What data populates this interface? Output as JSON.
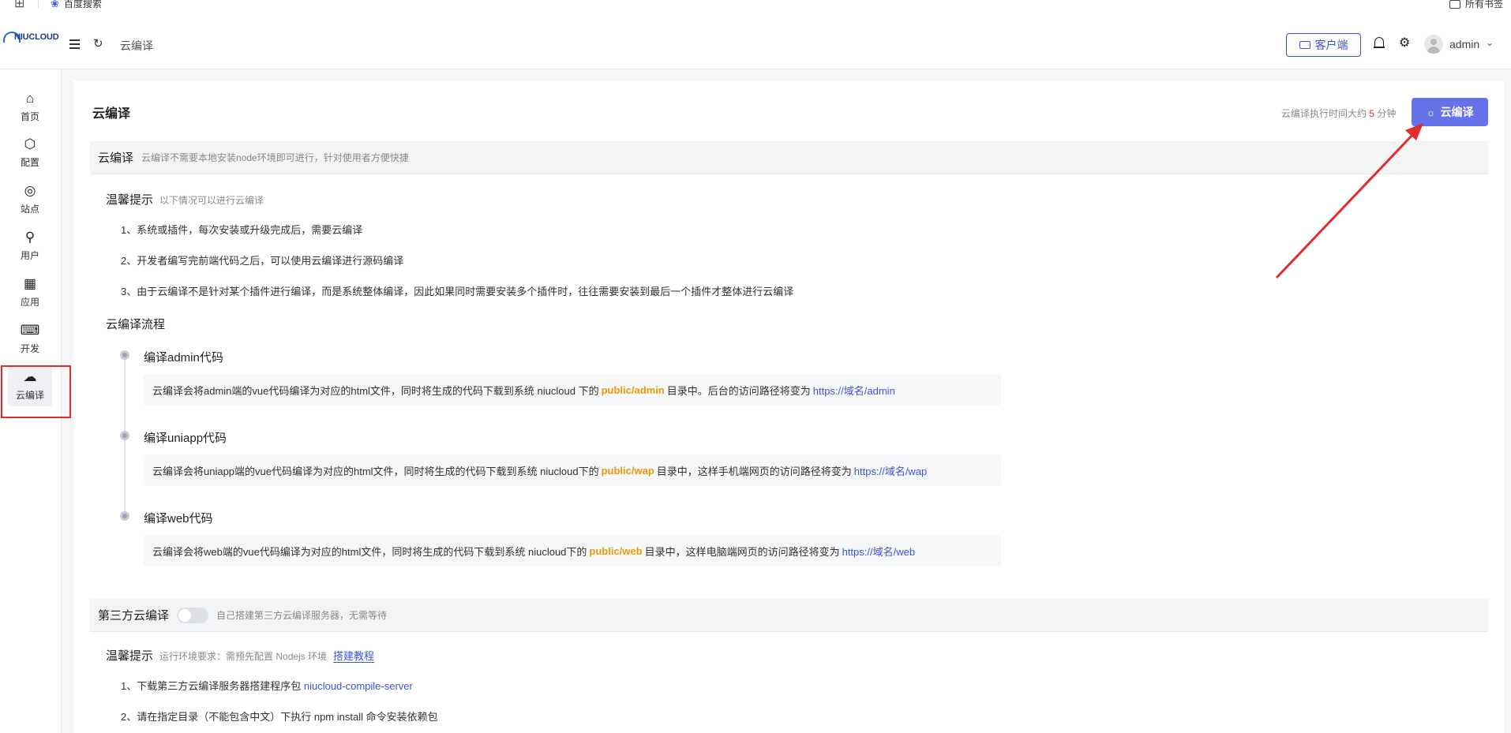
{
  "bookmarks": {
    "item": "百度搜索",
    "all": "所有书签"
  },
  "header": {
    "logo": "NIUCLOUD",
    "breadcrumb": "云编译",
    "client_button": "客户端",
    "username": "admin"
  },
  "sidebar": {
    "items": [
      {
        "label": "首页",
        "icon": "home-icon"
      },
      {
        "label": "配置",
        "icon": "config-icon"
      },
      {
        "label": "站点",
        "icon": "location-icon"
      },
      {
        "label": "用户",
        "icon": "user-icon"
      },
      {
        "label": "应用",
        "icon": "apps-icon"
      },
      {
        "label": "开发",
        "icon": "dev-icon"
      },
      {
        "label": "云编译",
        "icon": "cloud-icon"
      }
    ]
  },
  "page": {
    "title": "云编译",
    "exec_hint_prefix": "云编译执行时间大约",
    "exec_hint_num": "5",
    "exec_hint_suffix": "分钟",
    "compile_button": "云编译"
  },
  "section1": {
    "title": "云编译",
    "desc": "云编译不需要本地安装node环境即可进行，针对使用者方便快捷",
    "tips_title": "温馨提示",
    "tips_sub": "以下情况可以进行云编译",
    "tips": [
      "1、系统或插件，每次安装或升级完成后，需要云编译",
      "2、开发者编写完前端代码之后，可以使用云编译进行源码编译",
      "3、由于云编译不是针对某个插件进行编译，而是系统整体编译，因此如果同时需要安装多个插件时，往往需要安装到最后一个插件才整体进行云编译"
    ],
    "flow_title": "云编译流程",
    "flow": [
      {
        "title": "编译admin代码",
        "pre": "云编译会将admin端的vue代码编译为对应的html文件，同时将生成的代码下载到系统 niucloud 下的",
        "path": "public/admin",
        "mid": "目录中。后台的访问路径将变为",
        "url": "https://域名/admin"
      },
      {
        "title": "编译uniapp代码",
        "pre": "云编译会将uniapp端的vue代码编译为对应的html文件，同时将生成的代码下载到系统 niucloud下的",
        "path": "public/wap",
        "mid": "目录中，这样手机端网页的访问路径将变为",
        "url": "https://域名/wap"
      },
      {
        "title": "编译web代码",
        "pre": "云编译会将web端的vue代码编译为对应的html文件，同时将生成的代码下载到系统 niucloud下的",
        "path": "public/web",
        "mid": "目录中，这样电脑端网页的访问路径将变为",
        "url": "https://域名/web"
      }
    ]
  },
  "section2": {
    "title": "第三方云编译",
    "desc": "自己搭建第三方云编译服务器，无需等待",
    "toggle_on": false,
    "tips_title": "温馨提示",
    "tips_sub": "运行环境要求：需预先配置 Nodejs 环境",
    "tips_link": "搭建教程",
    "step1_text": "1、下载第三方云编译服务器搭建程序包",
    "step1_link": "niucloud-compile-server",
    "step2_text": "2、请在指定目录（不能包含中文）下执行 npm install 命令安装依赖包"
  },
  "colors": {
    "accent": "#3c52d9",
    "button": "#6672e8",
    "highlight": "#e89a0a",
    "annotation": "#e32b2b"
  }
}
